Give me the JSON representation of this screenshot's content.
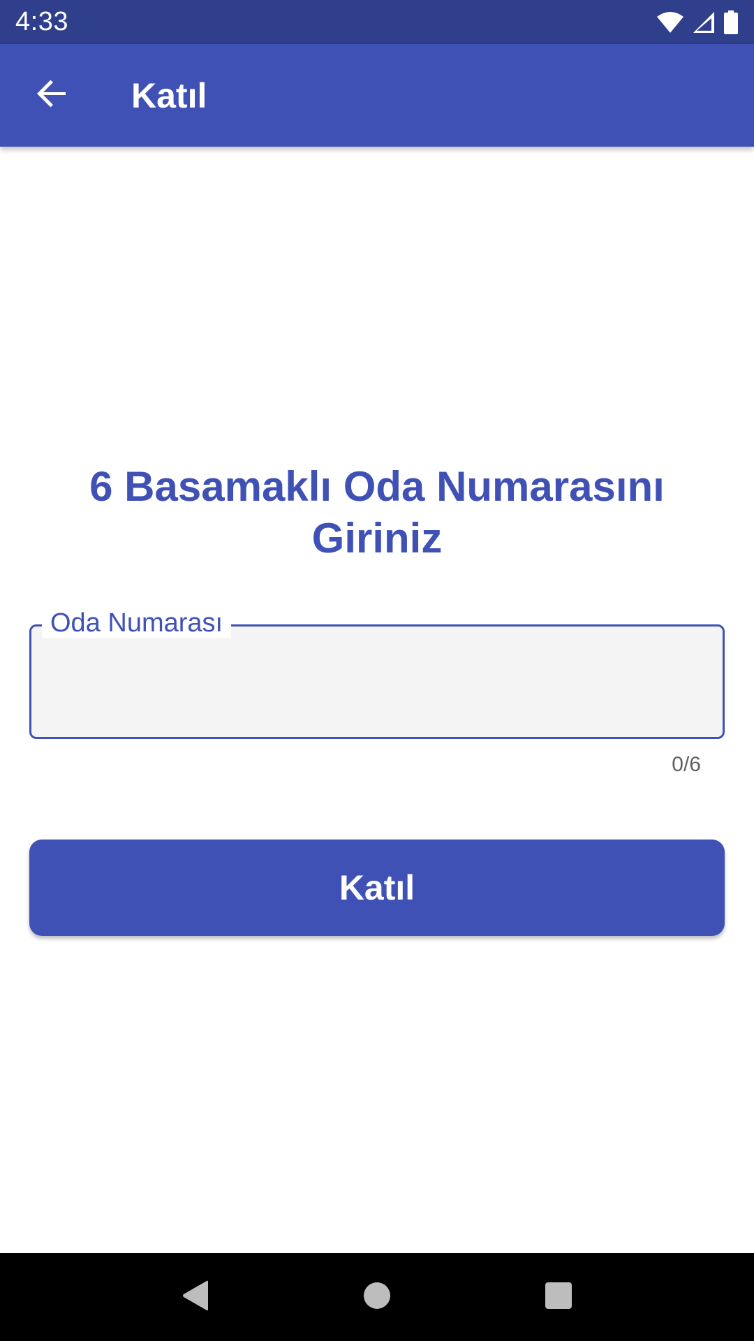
{
  "status_bar": {
    "time": "4:33",
    "icons": [
      "wifi-icon",
      "signal-icon",
      "battery-icon"
    ]
  },
  "app_bar": {
    "back_icon": "arrow-back-icon",
    "title": "Katıl"
  },
  "main": {
    "heading": "6 Basamaklı Oda Numarasını Giriniz",
    "room_field": {
      "label": "Oda Numarası",
      "value": "",
      "counter": "0/6"
    },
    "join_button_label": "Katıl"
  },
  "nav_bar": {
    "icons": [
      "back-triangle-icon",
      "home-circle-icon",
      "recents-square-icon"
    ]
  },
  "colors": {
    "primary": "#3F51B5",
    "primary_dark": "#303F8C",
    "field_background": "#F4F4F4",
    "counter_text": "#616161"
  }
}
